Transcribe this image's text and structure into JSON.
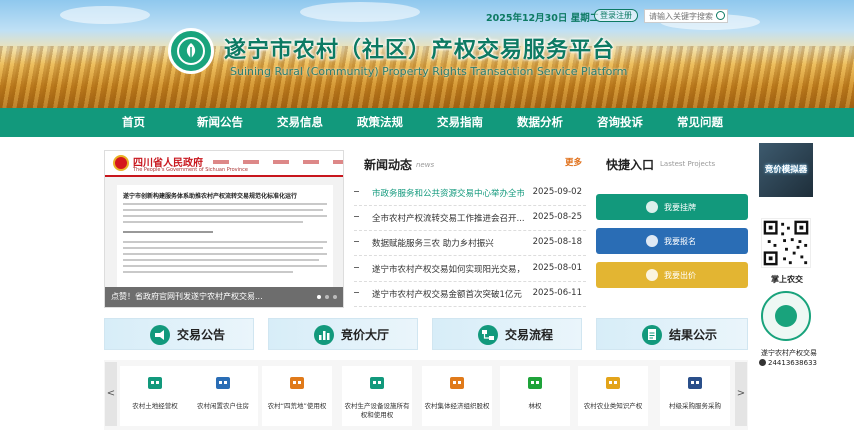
{
  "header": {
    "date": "2025年12月30日 星期二",
    "login_label": "登录注册",
    "search_placeholder": "请输入关键字搜索",
    "title_cn": "遂宁市农村（社区）产权交易服务平台",
    "title_en": "Suining Rural (Community) Property Rights Transaction Service Platform"
  },
  "nav": {
    "items": [
      "首页",
      "新闻公告",
      "交易信息",
      "政策法规",
      "交易指南",
      "数据分析",
      "咨询投诉",
      "常见问题"
    ]
  },
  "carousel": {
    "gov_name": "四川省人民政府",
    "gov_sub": "The People's Government of Sichuan Province",
    "doc_title": "遂宁市创新构建服务体系助推农村产权流转交易规范化标准化运行",
    "caption": "点赞！省政府官网刊发遂宁农村产权交易..."
  },
  "news": {
    "heading": "新闻动态",
    "heading_en": "news",
    "more": "更多",
    "items": [
      {
        "title": "市政务服务和公共资源交易中心举办全市",
        "date": "2025-09-02",
        "highlight": true
      },
      {
        "title": "全市农村产权流转交易工作推进会召开...",
        "date": "2025-08-25",
        "highlight": false
      },
      {
        "title": "数据赋能服务三农 助力乡村振兴",
        "date": "2025-08-18",
        "highlight": false
      },
      {
        "title": "遂宁市农村产权交易如何实现阳光交易，以...",
        "date": "2025-08-01",
        "highlight": false
      },
      {
        "title": "遂宁市农村产权交易金额首次突破1亿元",
        "date": "2025-06-11",
        "highlight": false
      }
    ]
  },
  "quick": {
    "heading": "快捷入口",
    "heading_en": "Lastest Projects",
    "buttons": [
      {
        "label": "我要挂牌",
        "color": "#12997c"
      },
      {
        "label": "我要报名",
        "color": "#2a6db5"
      },
      {
        "label": "我要出价",
        "color": "#e3b532"
      }
    ]
  },
  "sidebar": {
    "ad_text": "竞价模拟器",
    "qr_label": "掌上农交",
    "org_name": "遂宁农村产权交易",
    "phone": "24413638633"
  },
  "sections": [
    {
      "label": "交易公告",
      "icon": "megaphone-icon"
    },
    {
      "label": "竞价大厅",
      "icon": "bar-chart-icon"
    },
    {
      "label": "交易流程",
      "icon": "flow-icon"
    },
    {
      "label": "结果公示",
      "icon": "clipboard-icon"
    }
  ],
  "categories": [
    {
      "label": "农村土地经营权",
      "icon": "farm-house-icon",
      "color": "#12997c"
    },
    {
      "label": "农村闲置农户住房",
      "icon": "building-icon",
      "color": "#2a6db5"
    },
    {
      "label": "农村“四荒地”使用权",
      "icon": "wasteland-icon",
      "color": "#e07a1a"
    },
    {
      "label": "农村生产设备设施所有权和使用权",
      "icon": "tractor-icon",
      "color": "#12997c"
    },
    {
      "label": "农村集体经济组织股权",
      "icon": "stock-chart-icon",
      "color": "#e07a1a"
    },
    {
      "label": "林权",
      "icon": "tree-icon",
      "color": "#1fa33a"
    },
    {
      "label": "农村农业类知识产权",
      "icon": "box-icon",
      "color": "#e3a41a"
    },
    {
      "label": "村级采购服务采购",
      "icon": "wallet-icon",
      "color": "#2a4f8a"
    }
  ],
  "arrows": {
    "prev": "<",
    "next": ">"
  }
}
